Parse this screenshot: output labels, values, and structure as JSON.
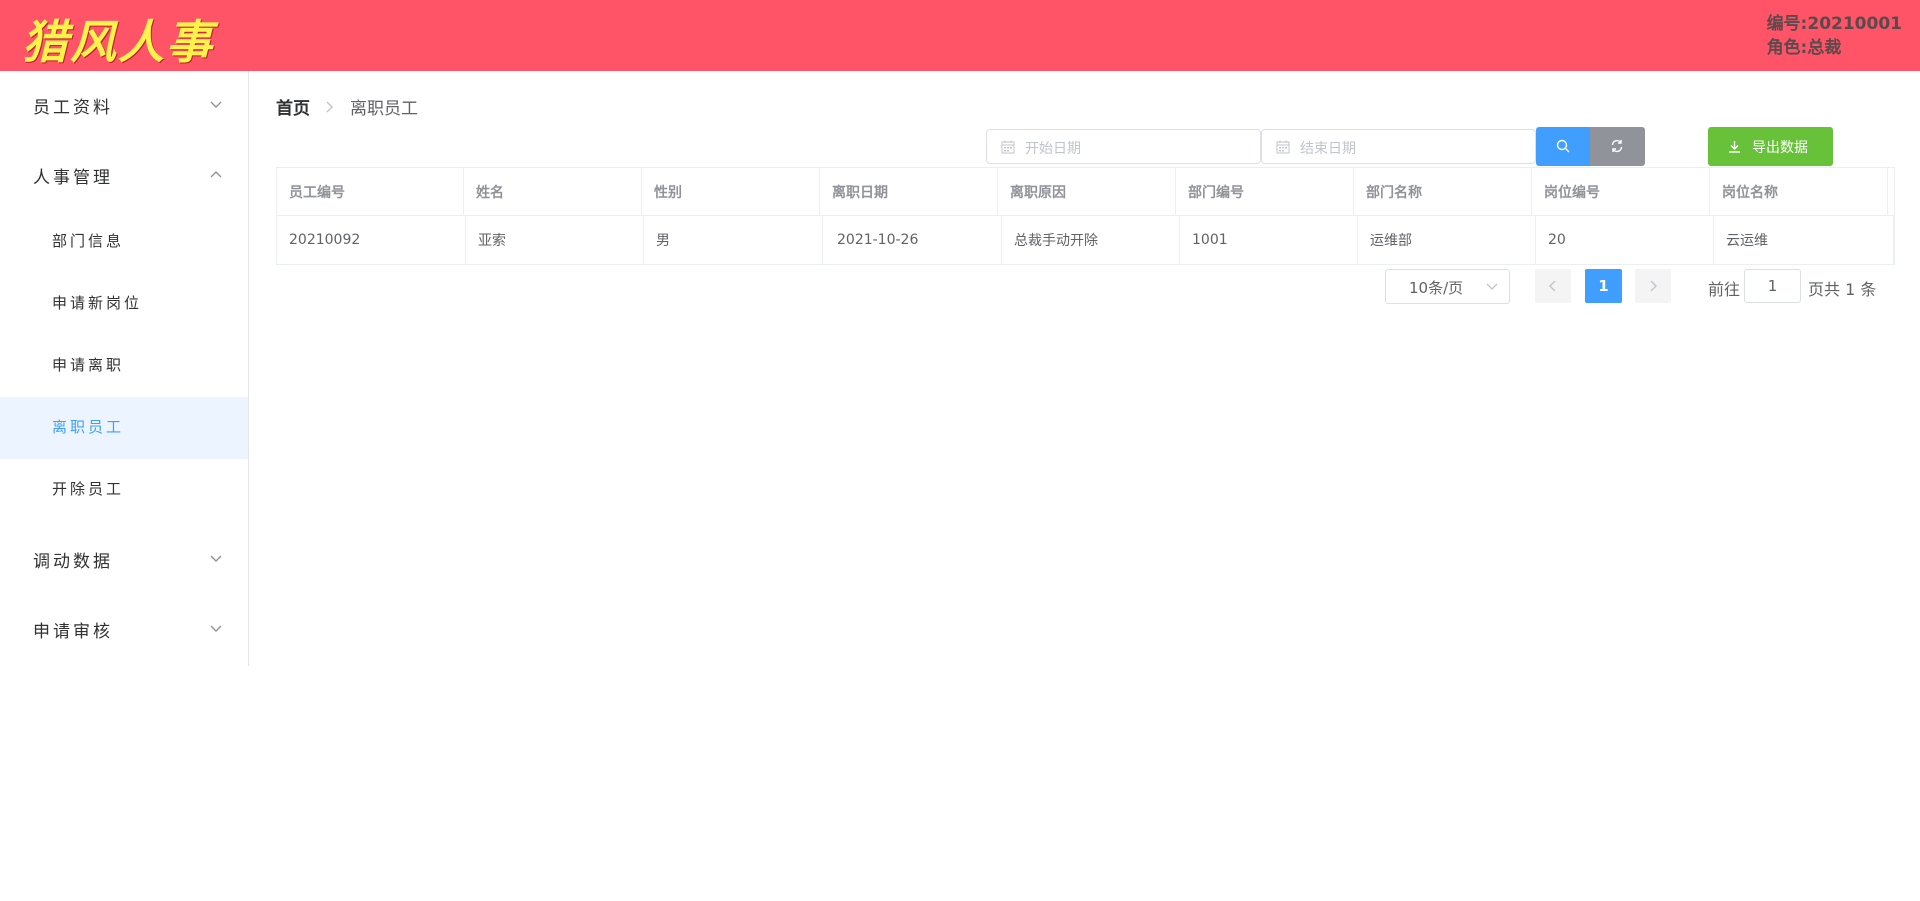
{
  "header": {
    "logo": "猎风人事",
    "user_id": "编号:20210001",
    "user_role": "角色:总裁"
  },
  "sidebar": {
    "groups": [
      {
        "label": "员工资料",
        "expanded": false
      },
      {
        "label": "人事管理",
        "expanded": true,
        "items": [
          {
            "label": "部门信息",
            "active": false
          },
          {
            "label": "申请新岗位",
            "active": false
          },
          {
            "label": "申请离职",
            "active": false
          },
          {
            "label": "离职员工",
            "active": true
          },
          {
            "label": "开除员工",
            "active": false
          }
        ]
      },
      {
        "label": "调动数据",
        "expanded": false
      },
      {
        "label": "申请审核",
        "expanded": false
      }
    ]
  },
  "breadcrumb": {
    "home": "首页",
    "current": "离职员工"
  },
  "filters": {
    "start_placeholder": "开始日期",
    "end_placeholder": "结束日期",
    "search_icon": "search-icon",
    "reset_icon": "refresh-icon",
    "export_label": "导出数据"
  },
  "table": {
    "columns": [
      "员工编号",
      "姓名",
      "性别",
      "离职日期",
      "离职原因",
      "部门编号",
      "部门名称",
      "岗位编号",
      "岗位名称"
    ],
    "rows": [
      [
        "20210092",
        "亚索",
        "男",
        "2021-10-26",
        "总裁手动开除",
        "1001",
        "运维部",
        "20",
        "云运维"
      ]
    ]
  },
  "pagination": {
    "page_size": "10条/页",
    "current_page": "1",
    "goto_label": "前往",
    "goto_value": "1",
    "total_text": "页共 1 条"
  },
  "colors": {
    "header_bg": "#ff5468",
    "logo": "#fff24a",
    "primary": "#409eff",
    "success": "#67c23a",
    "info": "#909399"
  }
}
